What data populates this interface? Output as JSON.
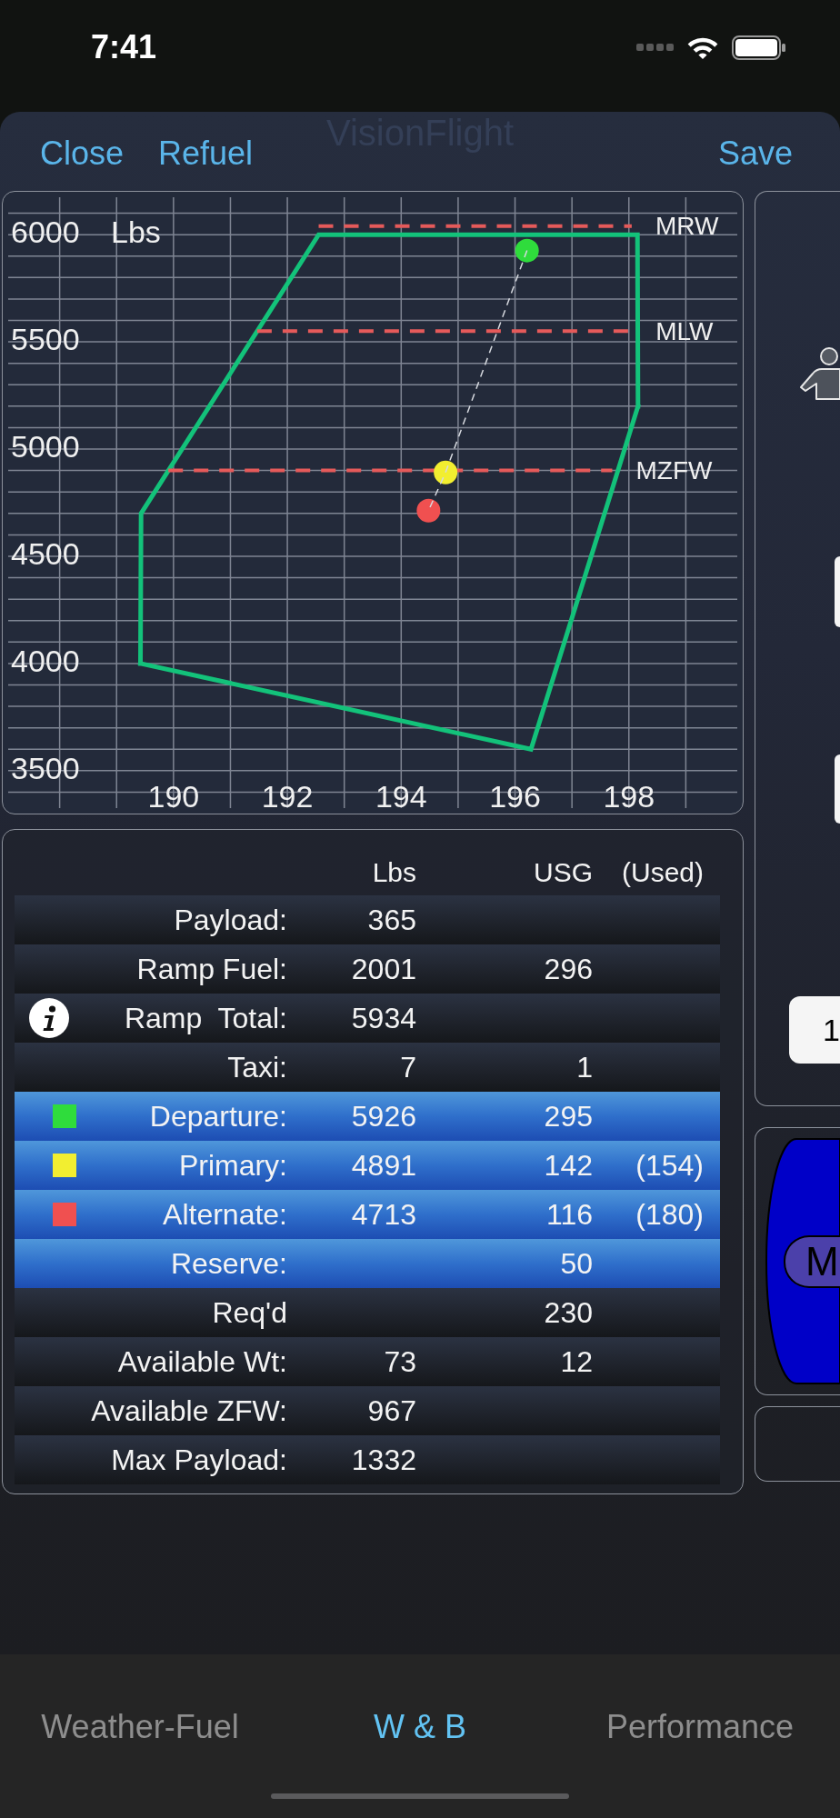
{
  "status_bar": {
    "time": "7:41"
  },
  "header": {
    "title": "VisionFlight",
    "left_buttons": [
      "Close",
      "Refuel"
    ],
    "right_buttons": [
      "Save"
    ]
  },
  "weight_chart": {
    "chart_data": {
      "type": "line",
      "ylabel": "Lbs",
      "grid": true,
      "xlim": [
        187,
        200
      ],
      "ylim": [
        3300,
        6200
      ],
      "xticks": [
        190,
        192,
        194,
        196,
        198
      ],
      "yticks": [
        3500,
        4000,
        4500,
        5000,
        5500,
        6000
      ],
      "x": [
        189.42,
        189.43,
        192.55,
        198.15,
        198.16,
        null,
        189.42,
        196.28,
        198.16,
        196.21,
        194.78,
        194.48
      ],
      "series": [
        {
          "color": "#13c27a",
          "values": [
            4000,
            4700,
            6000,
            6000,
            5200,
            null,
            4000,
            3600,
            5200,
            null,
            null,
            null
          ]
        },
        {
          "color": "#d6d9df",
          "line_style": "dashed",
          "values": [
            null,
            null,
            null,
            null,
            null,
            null,
            null,
            null,
            null,
            5926,
            4891,
            4713
          ]
        },
        {
          "color": "#2fdc3c",
          "marker": "circle",
          "values": [
            null,
            null,
            null,
            null,
            null,
            null,
            null,
            null,
            null,
            5926,
            null,
            null
          ]
        },
        {
          "color": "#f2ee30",
          "marker": "circle",
          "values": [
            null,
            null,
            null,
            null,
            null,
            null,
            null,
            null,
            null,
            null,
            4891,
            null
          ]
        },
        {
          "color": "#f05050",
          "marker": "circle",
          "values": [
            null,
            null,
            null,
            null,
            null,
            null,
            null,
            null,
            null,
            null,
            null,
            4713
          ]
        }
      ],
      "ref_lines": [
        {
          "axis": "y",
          "value": 6040,
          "label": "MRW"
        },
        {
          "axis": "y",
          "value": 5550,
          "label": "MLW"
        },
        {
          "axis": "y",
          "value": 4900,
          "label": "MZFW"
        }
      ]
    }
  },
  "summary_table": {
    "columns": [
      "Lbs",
      "USG",
      "(Used)"
    ],
    "rows": [
      {
        "label": "Payload:",
        "lbs": "365",
        "highlighted": false
      },
      {
        "label": "Ramp Fuel:",
        "lbs": "2001",
        "usg": "296",
        "highlighted": false
      },
      {
        "label": "Ramp  Total:",
        "lbs": "5934",
        "highlighted": false,
        "info": true
      },
      {
        "label": "Taxi:",
        "lbs": "7",
        "usg": "1",
        "highlighted": false
      },
      {
        "label": "Departure:",
        "lbs": "5926",
        "usg": "295",
        "highlighted": true,
        "color": "#2fdc3c"
      },
      {
        "label": "Primary:",
        "lbs": "4891",
        "usg": "142",
        "used": "(154)",
        "highlighted": true,
        "color": "#f2ee30"
      },
      {
        "label": "Alternate:",
        "lbs": "4713",
        "usg": "116",
        "used": "(180)",
        "highlighted": true,
        "color": "#f05050"
      },
      {
        "label": "Reserve:",
        "usg": "50",
        "highlighted": true
      },
      {
        "label": "Req'd",
        "usg": "230",
        "highlighted": false
      },
      {
        "label": "Available Wt:",
        "lbs": "73",
        "usg": "12",
        "highlighted": false
      },
      {
        "label": "Available ZFW:",
        "lbs": "967",
        "highlighted": false
      },
      {
        "label": "Max Payload:",
        "lbs": "1332",
        "highlighted": false
      }
    ]
  },
  "side_panel": {
    "field_value": "1",
    "tank_label": "M"
  },
  "tabs": [
    {
      "label": "Weather-Fuel",
      "selected": false
    },
    {
      "label": "W & B",
      "selected": true
    },
    {
      "label": "Performance",
      "selected": false
    }
  ]
}
